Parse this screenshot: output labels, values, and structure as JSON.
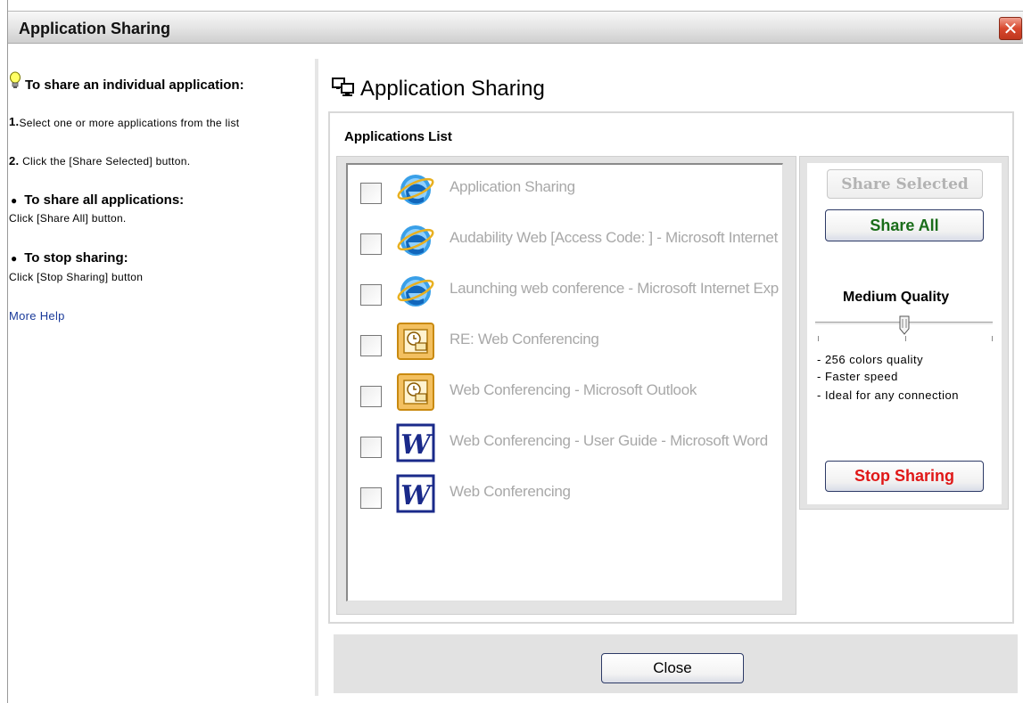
{
  "window": {
    "title": "Application Sharing",
    "close_glyph": "✕"
  },
  "help": {
    "individual_heading": "To share an individual application:",
    "step1_num": "1.",
    "step1_text": " Select one or more applications from the list",
    "step2_num": "2.",
    "step2_text": " Click the [Share Selected] button.",
    "all_heading": "To share all applications:",
    "all_text": "Click [Share All] button.",
    "stop_heading": "To stop sharing:",
    "stop_text": "Click [Stop Sharing] button",
    "bullet": "●",
    "more_help": "More Help"
  },
  "main": {
    "title": "Application Sharing",
    "list_label": "Applications List",
    "applications": [
      {
        "name": "Application Sharing",
        "icon": "ie-icon",
        "checked": false
      },
      {
        "name": "Audability Web [Access Code:            ] - Microsoft Internet Explorer",
        "icon": "ie-icon",
        "checked": false
      },
      {
        "name": "Launching web conference - Microsoft Internet Explorer",
        "icon": "ie-icon",
        "checked": false
      },
      {
        "name": "RE: Web Conferencing",
        "icon": "outlook-icon",
        "checked": false
      },
      {
        "name": "Web Conferencing - Microsoft Outlook",
        "icon": "outlook-icon",
        "checked": false
      },
      {
        "name": "Web Conferencing - User Guide - Microsoft Word",
        "icon": "word-icon",
        "checked": false
      },
      {
        "name": "Web Conferencing",
        "icon": "word-icon",
        "checked": false
      }
    ]
  },
  "controls": {
    "share_selected": "Share Selected",
    "share_all": "Share All",
    "quality_label": "Medium Quality",
    "quality_level": 0.5,
    "quality_desc": [
      "- 256 colors quality",
      "- Faster speed",
      "- Ideal for any connection"
    ],
    "stop_sharing": "Stop Sharing"
  },
  "footer": {
    "close": "Close"
  },
  "colors": {
    "share_all": "#1a6d1a",
    "stop_sharing": "#e01818",
    "disabled": "#b3b3b3",
    "link": "#1a3a9a"
  }
}
